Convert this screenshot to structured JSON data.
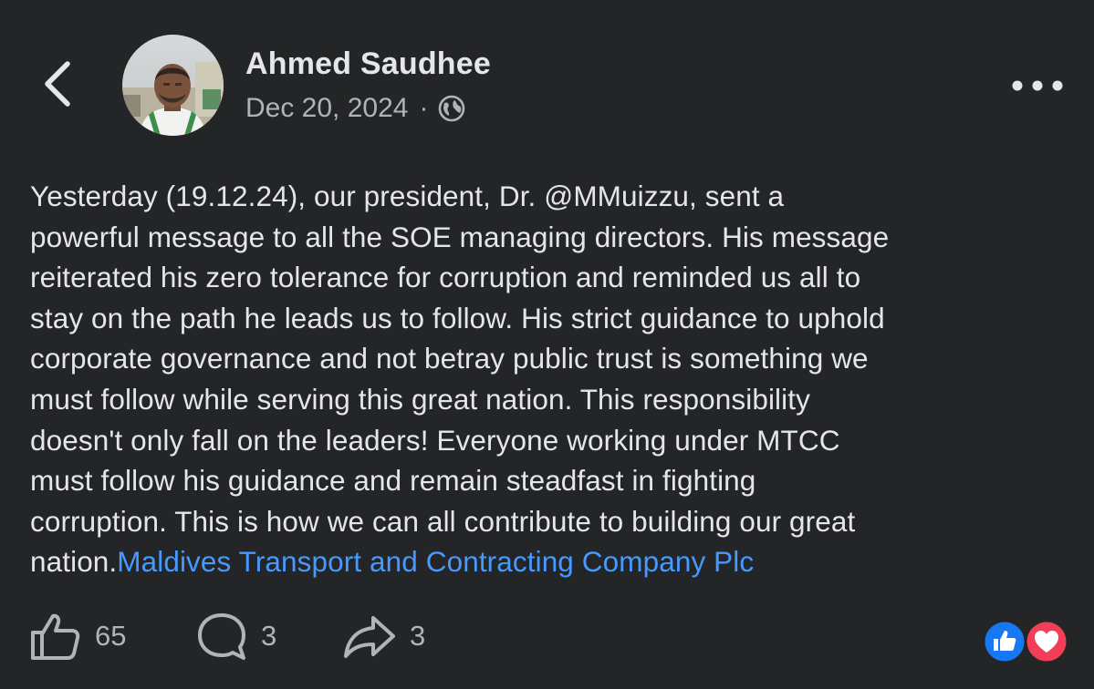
{
  "header": {
    "author_name": "Ahmed Saudhee",
    "date": "Dec 20, 2024",
    "separator": "·",
    "back_icon": "chevron-left-icon",
    "privacy_icon": "globe-icon",
    "more_icon": "more-horizontal-icon"
  },
  "post": {
    "lines": [
      "Yesterday (19.12.24), our president, Dr. @MMuizzu, sent a",
      "powerful message to all the SOE managing directors. His message",
      "reiterated his zero tolerance for corruption and reminded us all to",
      "stay on the path he leads us to follow. His strict guidance to uphold",
      "corporate governance and not betray public trust is something we",
      "must follow while serving this great nation. This responsibility",
      "doesn't only fall on the leaders! Everyone working under MTCC",
      "must follow his guidance and remain steadfast in fighting",
      "corruption. This is how we can all contribute to building our great"
    ],
    "last_line_text": "nation.",
    "tagged_page": "Maldives Transport and Contracting Company Plc"
  },
  "actions": {
    "likes": "65",
    "comments": "3",
    "shares": "3"
  },
  "reactions": [
    "like",
    "love"
  ],
  "colors": {
    "background": "#242526",
    "text": "#e4e6eb",
    "secondary_text": "#b0b3b8",
    "link": "#4599ff",
    "like_blue": "#1877f2",
    "love_red": "#f33e58"
  }
}
